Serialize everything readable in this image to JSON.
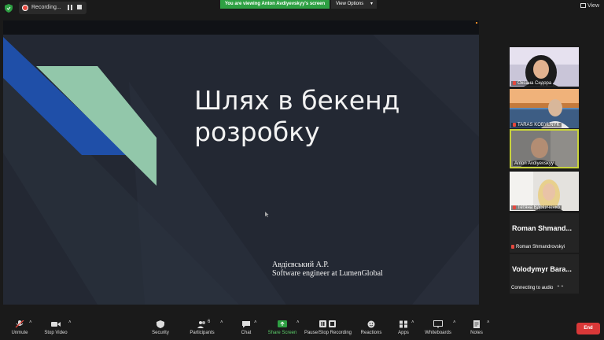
{
  "topbar": {
    "recording_label": "Recording...",
    "viewing_banner": "You are viewing Anton Avdiyevskyy's screen",
    "view_options": "View Options",
    "view_label": "View"
  },
  "slide": {
    "title_line1": "Шлях в бекенд",
    "title_line2": "розробку",
    "author_line1": "Авдієвський А.Р.",
    "author_line2": "Software engineer at LumenGlobal",
    "colors": {
      "background": "#232833",
      "blue": "#1f4fa8",
      "mint": "#92c7aa"
    }
  },
  "participants": [
    {
      "name": "Оксана Сидора",
      "type": "video",
      "muted": true
    },
    {
      "name": "TARAS KOBYLNYK",
      "type": "video",
      "muted": true
    },
    {
      "name": "Anton Avdiyevskyy",
      "type": "video",
      "muted": false,
      "active": true
    },
    {
      "name": "Тетяна Вдовиченко",
      "type": "video",
      "muted": true
    },
    {
      "name": "Roman  Shmand...",
      "subname": "Roman Shmandrovskyi",
      "type": "name-only",
      "muted": true
    },
    {
      "name": "Volodymyr  Bara...",
      "subname": "Connecting to audio",
      "type": "name-only",
      "muted": false
    }
  ],
  "toolbar": {
    "unmute": "Unmute",
    "stop_video": "Stop Video",
    "security": "Security",
    "participants": "Participants",
    "participants_count": "6",
    "chat": "Chat",
    "share_screen": "Share Screen",
    "recording": "Pause/Stop Recording",
    "reactions": "Reactions",
    "apps": "Apps",
    "whiteboards": "Whiteboards",
    "notes": "Notes",
    "end": "End"
  }
}
